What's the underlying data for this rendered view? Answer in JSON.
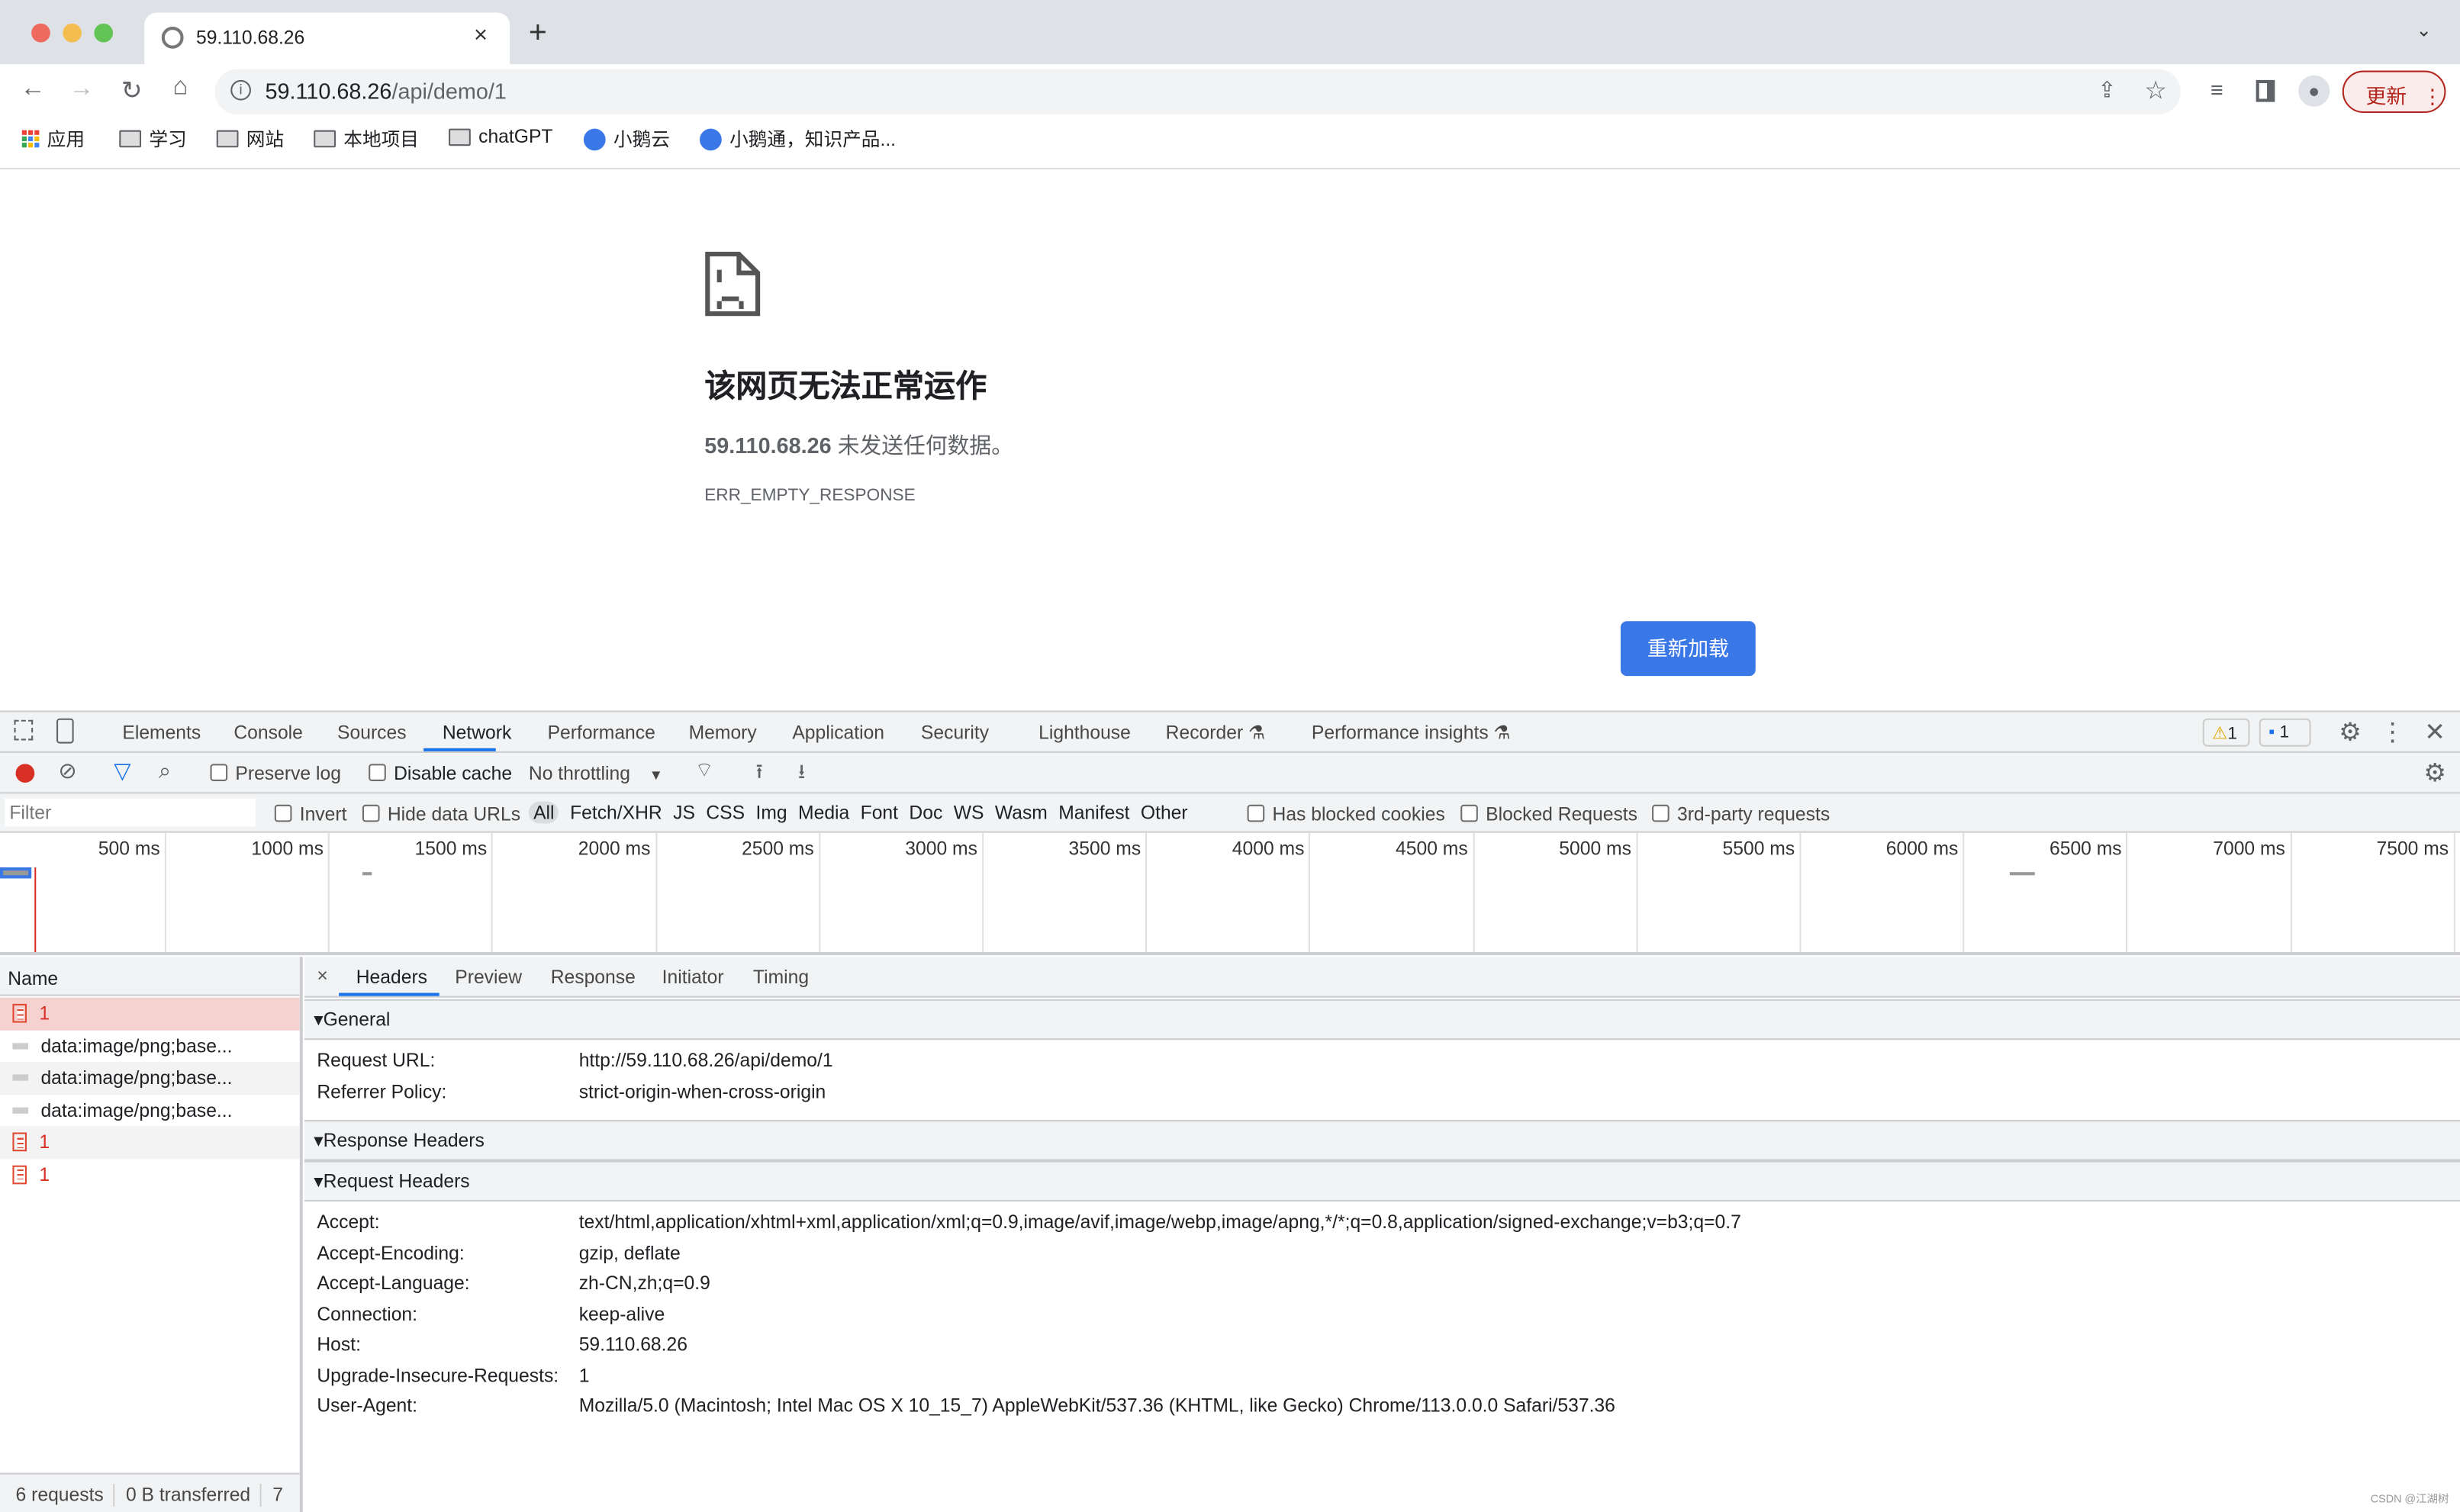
{
  "browser": {
    "tab_title": "59.110.68.26",
    "address_host": "59.110.68.26",
    "address_path": "/api/demo/1",
    "update_button": "更新",
    "bookmarks": [
      {
        "label": "应用",
        "icon": "apps-grid-icon"
      },
      {
        "label": "学习",
        "icon": "folder-icon"
      },
      {
        "label": "网站",
        "icon": "folder-icon"
      },
      {
        "label": "本地项目",
        "icon": "folder-icon"
      },
      {
        "label": "chatGPT",
        "icon": "folder-icon"
      },
      {
        "label": "小鹅云",
        "icon": "site-logo-icon"
      },
      {
        "label": "小鹅通，知识产品...",
        "icon": "site-logo-icon"
      }
    ]
  },
  "page": {
    "title": "该网页无法正常运作",
    "host_bold": "59.110.68.26",
    "message": " 未发送任何数据。",
    "error_code": "ERR_EMPTY_RESPONSE",
    "reload_button": "重新加载",
    "accent": "#3b78e7"
  },
  "devtools": {
    "tabs": [
      "Elements",
      "Console",
      "Sources",
      "Network",
      "Performance",
      "Memory",
      "Application",
      "Security",
      "Lighthouse",
      "Recorder",
      "Performance insights"
    ],
    "active_tab": "Network",
    "warnings": "1",
    "messages": "1",
    "toolbar": {
      "preserve_log": "Preserve log",
      "disable_cache": "Disable cache",
      "throttling": "No throttling"
    },
    "filter": {
      "placeholder": "Filter",
      "invert": "Invert",
      "hide_data_urls": "Hide data URLs",
      "types": [
        "All",
        "Fetch/XHR",
        "JS",
        "CSS",
        "Img",
        "Media",
        "Font",
        "Doc",
        "WS",
        "Wasm",
        "Manifest",
        "Other"
      ],
      "has_blocked_cookies": "Has blocked cookies",
      "blocked_requests": "Blocked Requests",
      "third_party": "3rd-party requests"
    },
    "timeline_ticks": [
      "500 ms",
      "1000 ms",
      "1500 ms",
      "2000 ms",
      "2500 ms",
      "3000 ms",
      "3500 ms",
      "4000 ms",
      "4500 ms",
      "5000 ms",
      "5500 ms",
      "6000 ms",
      "6500 ms",
      "7000 ms",
      "7500 ms"
    ],
    "name_header": "Name",
    "requests": [
      {
        "name": "1",
        "type": "document",
        "error": true,
        "selected": true
      },
      {
        "name": "data:image/png;base...",
        "type": "image"
      },
      {
        "name": "data:image/png;base...",
        "type": "image"
      },
      {
        "name": "data:image/png;base...",
        "type": "image"
      },
      {
        "name": "1",
        "type": "document",
        "error": true
      },
      {
        "name": "1",
        "type": "document",
        "error": true
      }
    ],
    "status_bar": {
      "requests": "6 requests",
      "transferred": "0 B transferred",
      "extra": "7"
    },
    "detail_tabs": [
      "Headers",
      "Preview",
      "Response",
      "Initiator",
      "Timing"
    ],
    "general": {
      "title": "General",
      "rows": [
        {
          "k": "Request URL:",
          "v": "http://59.110.68.26/api/demo/1"
        },
        {
          "k": "Referrer Policy:",
          "v": "strict-origin-when-cross-origin"
        }
      ]
    },
    "response_headers_title": "Response Headers",
    "request_headers": {
      "title": "Request Headers",
      "rows": [
        {
          "k": "Accept:",
          "v": "text/html,application/xhtml+xml,application/xml;q=0.9,image/avif,image/webp,image/apng,*/*;q=0.8,application/signed-exchange;v=b3;q=0.7"
        },
        {
          "k": "Accept-Encoding:",
          "v": "gzip, deflate"
        },
        {
          "k": "Accept-Language:",
          "v": "zh-CN,zh;q=0.9"
        },
        {
          "k": "Connection:",
          "v": "keep-alive"
        },
        {
          "k": "Host:",
          "v": "59.110.68.26"
        },
        {
          "k": "Upgrade-Insecure-Requests:",
          "v": "1"
        },
        {
          "k": "User-Agent:",
          "v": "Mozilla/5.0 (Macintosh; Intel Mac OS X 10_15_7) AppleWebKit/537.36 (KHTML, like Gecko) Chrome/113.0.0.0 Safari/537.36"
        }
      ]
    }
  },
  "watermark": "CSDN @江湖树"
}
